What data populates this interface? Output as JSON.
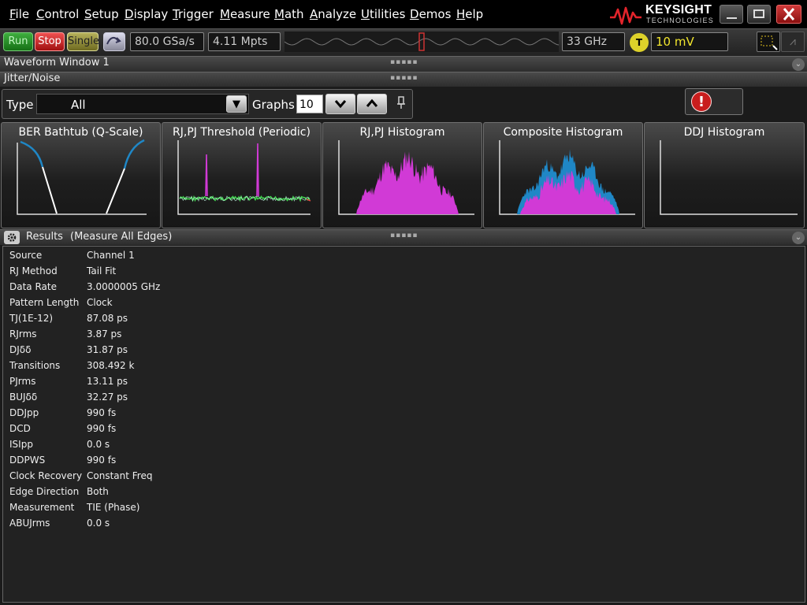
{
  "menu": [
    "File",
    "Control",
    "Setup",
    "Display",
    "Trigger",
    "Measure",
    "Math",
    "Analyze",
    "Utilities",
    "Demos",
    "Help"
  ],
  "brand": {
    "name": "KEYSIGHT",
    "sub": "TECHNOLOGIES",
    "accent": "#e3242b"
  },
  "toolbar": {
    "run_label": "Run",
    "stop_label": "Stop",
    "single_label": "Single",
    "sample_rate": "80.0 GSa/s",
    "memory_depth": "4.11 Mpts",
    "bandwidth": "33 GHz",
    "trigger_badge": "T",
    "trigger_level": "10 mV"
  },
  "panels": {
    "waveform_title": "Waveform Window 1",
    "jitter_title": "Jitter/Noise",
    "results_title": "Results",
    "results_subtitle": "(Measure All Edges)"
  },
  "controls": {
    "type_label": "Type",
    "type_value": "All",
    "graphs_label": "Graphs",
    "graphs_value": "10",
    "alert_glyph": "!"
  },
  "graphs": [
    {
      "title": "BER Bathtub (Q-Scale)"
    },
    {
      "title": "RJ,PJ Threshold (Periodic)"
    },
    {
      "title": "RJ,PJ Histogram"
    },
    {
      "title": "Composite Histogram"
    },
    {
      "title": "DDJ Histogram"
    }
  ],
  "colors": {
    "magenta": "#d13ad6",
    "blue": "#1f87c6",
    "noise_green": "#3fcf4c"
  },
  "results": [
    {
      "label": "Source",
      "value": "Channel 1"
    },
    {
      "label": "RJ Method",
      "value": "Tail Fit"
    },
    {
      "label": "Data Rate",
      "value": "3.0000005 GHz"
    },
    {
      "label": "Pattern Length",
      "value": "Clock"
    },
    {
      "label": "TJ(1E-12)",
      "value": "87.08 ps"
    },
    {
      "label": "RJrms",
      "value": "3.87 ps"
    },
    {
      "label": "DJδδ",
      "value": "31.87 ps"
    },
    {
      "label": "Transitions",
      "value": "308.492 k"
    },
    {
      "label": "PJrms",
      "value": "13.11 ps"
    },
    {
      "label": "BUJδδ",
      "value": "32.27 ps"
    },
    {
      "label": "DDJpp",
      "value": "990 fs"
    },
    {
      "label": "DCD",
      "value": "990 fs"
    },
    {
      "label": "ISIpp",
      "value": "0.0 s"
    },
    {
      "label": "DDPWS",
      "value": "990 fs"
    },
    {
      "label": "Clock Recovery",
      "value": "Constant Freq"
    },
    {
      "label": "Edge Direction",
      "value": "Both"
    },
    {
      "label": "Measurement",
      "value": "TIE (Phase)"
    },
    {
      "label": "ABUJrms",
      "value": "0.0 s"
    }
  ]
}
